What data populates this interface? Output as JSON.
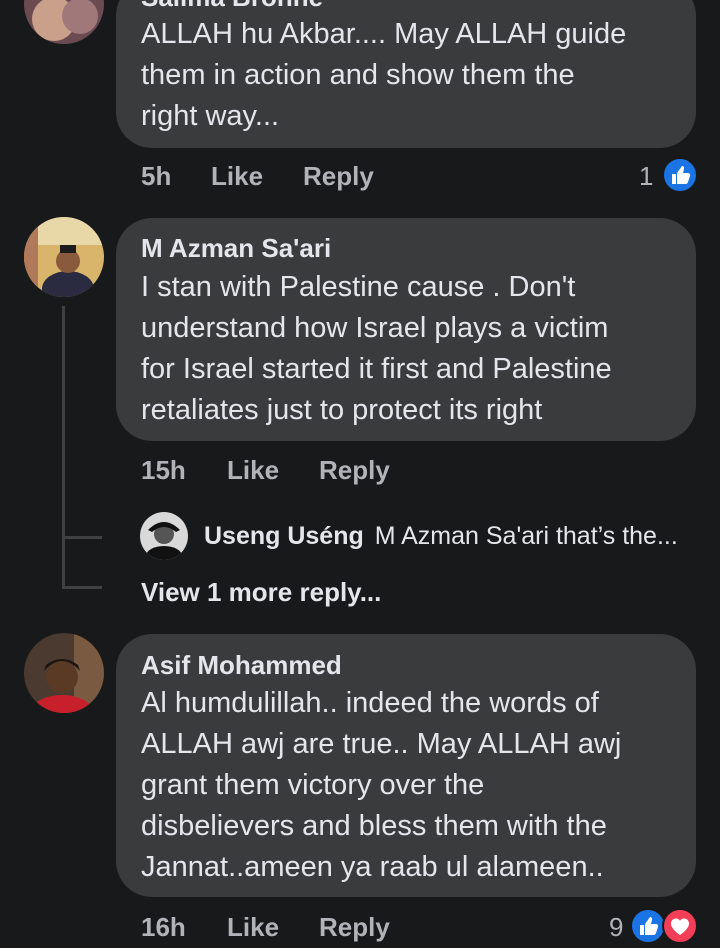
{
  "comments": [
    {
      "author": "Salima Bronne",
      "lines": [
        "ALLAH hu Akbar.... May ALLAH guide",
        "them in action and show them the",
        "right way..."
      ],
      "time": "5h",
      "like_label": "Like",
      "reply_label": "Reply",
      "reaction_count": "1"
    },
    {
      "author": "M Azman Sa'ari",
      "lines": [
        "I stan with Palestine cause . Don't",
        "understand how Israel plays a victim",
        "for Israel started it first and Palestine",
        "retaliates just to protect its right"
      ],
      "time": "15h",
      "like_label": "Like",
      "reply_label": "Reply"
    },
    {
      "author": "Asif Mohammed",
      "lines": [
        "Al humdulillah.. indeed the words of",
        "ALLAH awj are true.. May ALLAH awj",
        "grant them victory over the",
        "disbelievers and bless them with the",
        "Jannat..ameen ya raab ul alameen.."
      ],
      "time": "16h",
      "like_label": "Like",
      "reply_label": "Reply",
      "reaction_count": "9"
    }
  ],
  "reply_preview": {
    "author": "Useng Uséng",
    "text": "M Azman Sa'ari that’s the..."
  },
  "view_more_replies": "View 1 more reply...",
  "colors": {
    "background": "#18191a",
    "bubble": "#3a3b3c",
    "text": "#e4e6eb",
    "secondary_text": "#b0b3b8",
    "like_blue": "#1b74e4",
    "love_red": "#f33e58"
  },
  "icons": [
    "like-reaction-icon",
    "love-reaction-icon"
  ]
}
